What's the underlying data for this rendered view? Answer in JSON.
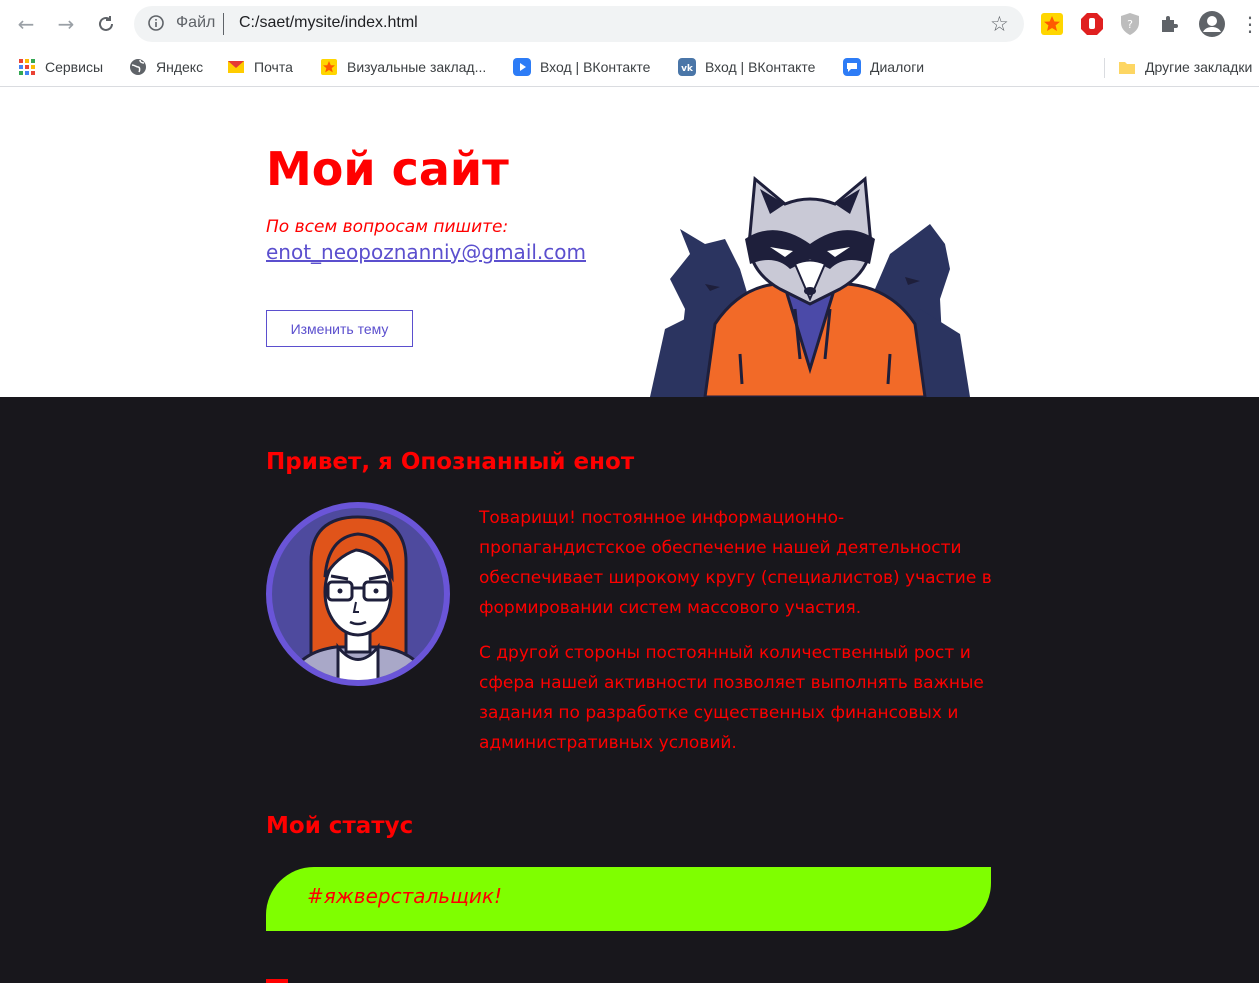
{
  "browser": {
    "address_scheme": "Файл",
    "address_url": "C:/saet/mysite/index.html"
  },
  "bookmarks": [
    {
      "label": "Сервисы",
      "icon": "apps-grid-icon"
    },
    {
      "label": "Яндекс",
      "icon": "globe-icon"
    },
    {
      "label": "Почта",
      "icon": "mail-icon"
    },
    {
      "label": "Визуальные заклад...",
      "icon": "star-tab-icon"
    },
    {
      "label": "Вход | ВКонтакте",
      "icon": "play-icon"
    },
    {
      "label": "Вход | ВКонтакте",
      "icon": "vk-icon"
    },
    {
      "label": "Диалоги",
      "icon": "chat-icon"
    }
  ],
  "other_bookmarks": "Другие закладки",
  "header": {
    "title": "Мой сайт",
    "contact_label": "По всем вопросам пишите:",
    "email": "enot_neopoznanniy@gmail.com",
    "theme_button": "Изменить тему"
  },
  "about": {
    "title": "Привет, я Опознанный енот",
    "paragraphs": [
      "Товарищи! постоянное информационно-пропагандистское обеспечение нашей деятельности обеспечивает широкому кругу (специалистов) участие в формировании систем массового участия.",
      "С другой стороны постоянный количественный рост и сфера нашей активности позволяет выполнять важные задания по разработке существенных финансовых и административных условий."
    ]
  },
  "status": {
    "title": "Мой статус",
    "text": "#яжверстальщик!"
  },
  "colors": {
    "accent_red": "#ff0000",
    "link_purple": "#5b4fce",
    "dark_bg": "#18171c",
    "status_green": "#7fff00"
  }
}
